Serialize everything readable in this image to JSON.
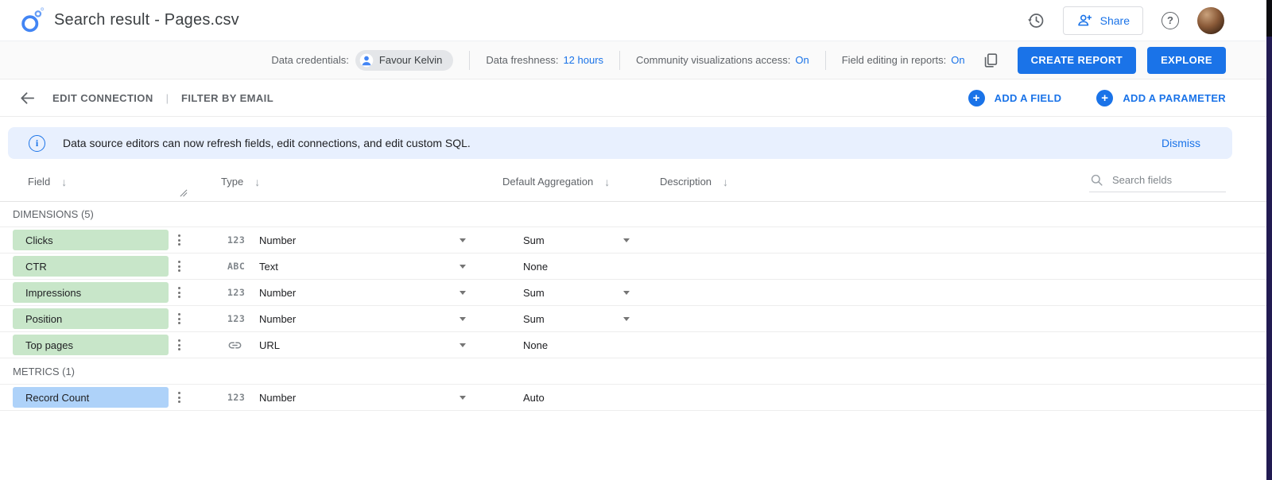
{
  "colors": {
    "accent": "#1a73e8",
    "logo-blue": "#4285f4",
    "dim-chip": "#c8e6c9",
    "metric-chip": "#aed2f9",
    "banner-bg": "#e8f0fe",
    "edge-strip": "#221b52"
  },
  "header": {
    "title": "Search result - Pages.csv",
    "share_label": "Share"
  },
  "settings": {
    "credentials_label": "Data credentials:",
    "credentials_value": "Favour Kelvin",
    "freshness_label": "Data freshness:",
    "freshness_value": "12 hours",
    "community_label": "Community visualizations access:",
    "community_value": "On",
    "field_editing_label": "Field editing in reports:",
    "field_editing_value": "On",
    "create_report": "CREATE REPORT",
    "explore": "EXPLORE"
  },
  "connection": {
    "edit_connection": "EDIT CONNECTION",
    "divider": "|",
    "filter_by_email": "FILTER BY EMAIL",
    "add_field": "ADD A FIELD",
    "add_parameter": "ADD A PARAMETER"
  },
  "banner": {
    "message": "Data source editors can now refresh fields, edit connections, and edit custom SQL.",
    "dismiss": "Dismiss"
  },
  "table": {
    "columns": [
      {
        "label": "Field"
      },
      {
        "label": "Type"
      },
      {
        "label": "Default Aggregation"
      },
      {
        "label": "Description"
      }
    ],
    "search_placeholder": "Search fields",
    "sections": [
      {
        "label": "DIMENSIONS (5)",
        "rows": [
          {
            "field": "Clicks",
            "type_glyph": "123",
            "type": "Number",
            "aggregation": "Sum",
            "agg_dropdown": true
          },
          {
            "field": "CTR",
            "type_glyph": "ABC",
            "type": "Text",
            "aggregation": "None",
            "agg_dropdown": false
          },
          {
            "field": "Impressions",
            "type_glyph": "123",
            "type": "Number",
            "aggregation": "Sum",
            "agg_dropdown": true
          },
          {
            "field": "Position",
            "type_glyph": "123",
            "type": "Number",
            "aggregation": "Sum",
            "agg_dropdown": true
          },
          {
            "field": "Top pages",
            "type_icon": "url",
            "type": "URL",
            "aggregation": "None",
            "agg_dropdown": false
          }
        ]
      },
      {
        "label": "METRICS (1)",
        "rows": [
          {
            "field": "Record Count",
            "type_glyph": "123",
            "type": "Number",
            "aggregation": "Auto",
            "agg_dropdown": false
          }
        ]
      }
    ]
  },
  "icons": {
    "sort_down": "↓",
    "help": "?",
    "info": "i",
    "plus": "+"
  }
}
